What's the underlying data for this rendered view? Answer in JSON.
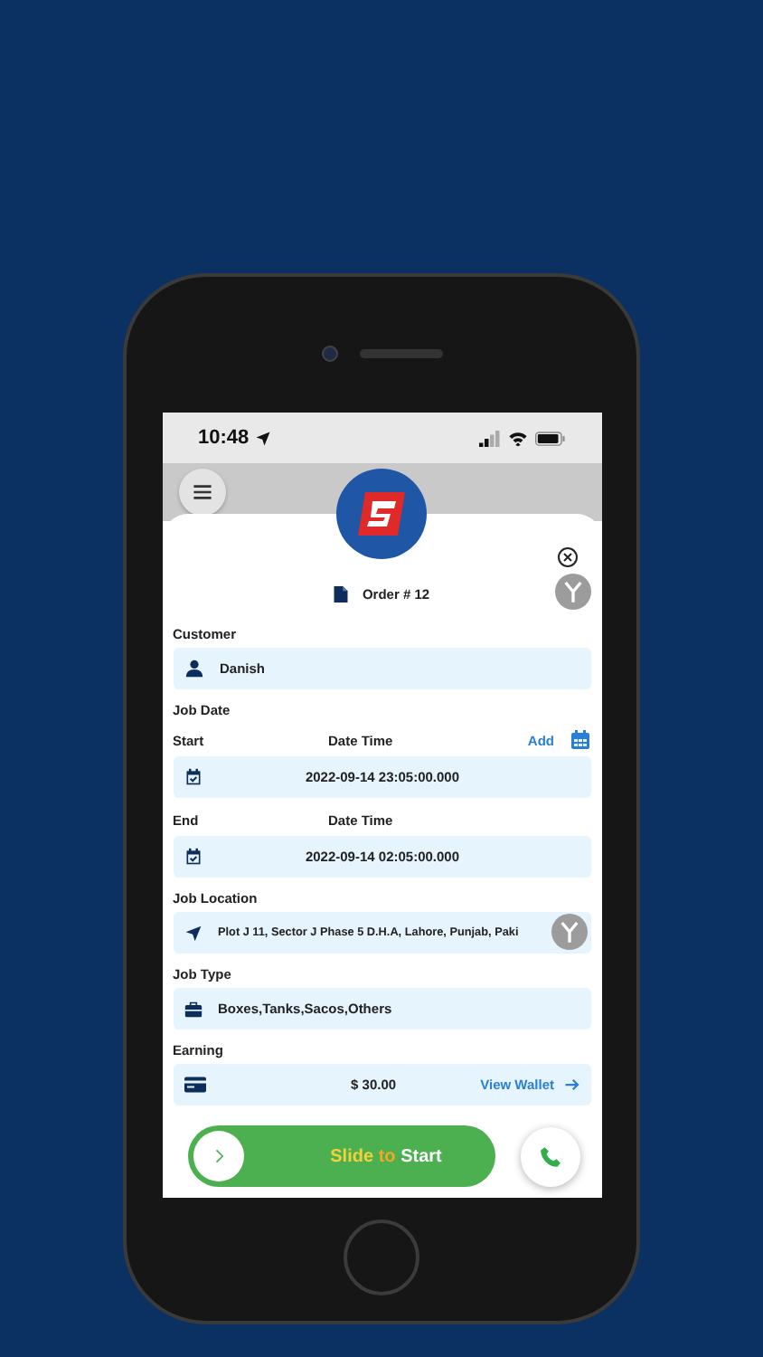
{
  "status_bar": {
    "time": "10:48"
  },
  "order": {
    "title": "Order # 12"
  },
  "customer": {
    "label": "Customer",
    "value": "Danish"
  },
  "job_date": {
    "label": "Job Date",
    "add_link": "Add",
    "start": {
      "label": "Start",
      "column": "Date Time",
      "value": "2022-09-14 23:05:00.000"
    },
    "end": {
      "label": "End",
      "column": "Date Time",
      "value": "2022-09-14 02:05:00.000"
    }
  },
  "job_location": {
    "label": "Job Location",
    "value": "Plot J 11, Sector J Phase 5 D.H.A, Lahore, Punjab, Paki"
  },
  "job_type": {
    "label": "Job Type",
    "value": "Boxes,Tanks,Sacos,Others"
  },
  "earning": {
    "label": "Earning",
    "value": "$ 30.00",
    "link": "View Wallet"
  },
  "slider": {
    "parts": [
      {
        "text": "Slide",
        "color": "#f2d13a"
      },
      {
        "text": "to",
        "color": "#f5a623"
      },
      {
        "text": "Start",
        "color": "#ffffff"
      }
    ]
  }
}
